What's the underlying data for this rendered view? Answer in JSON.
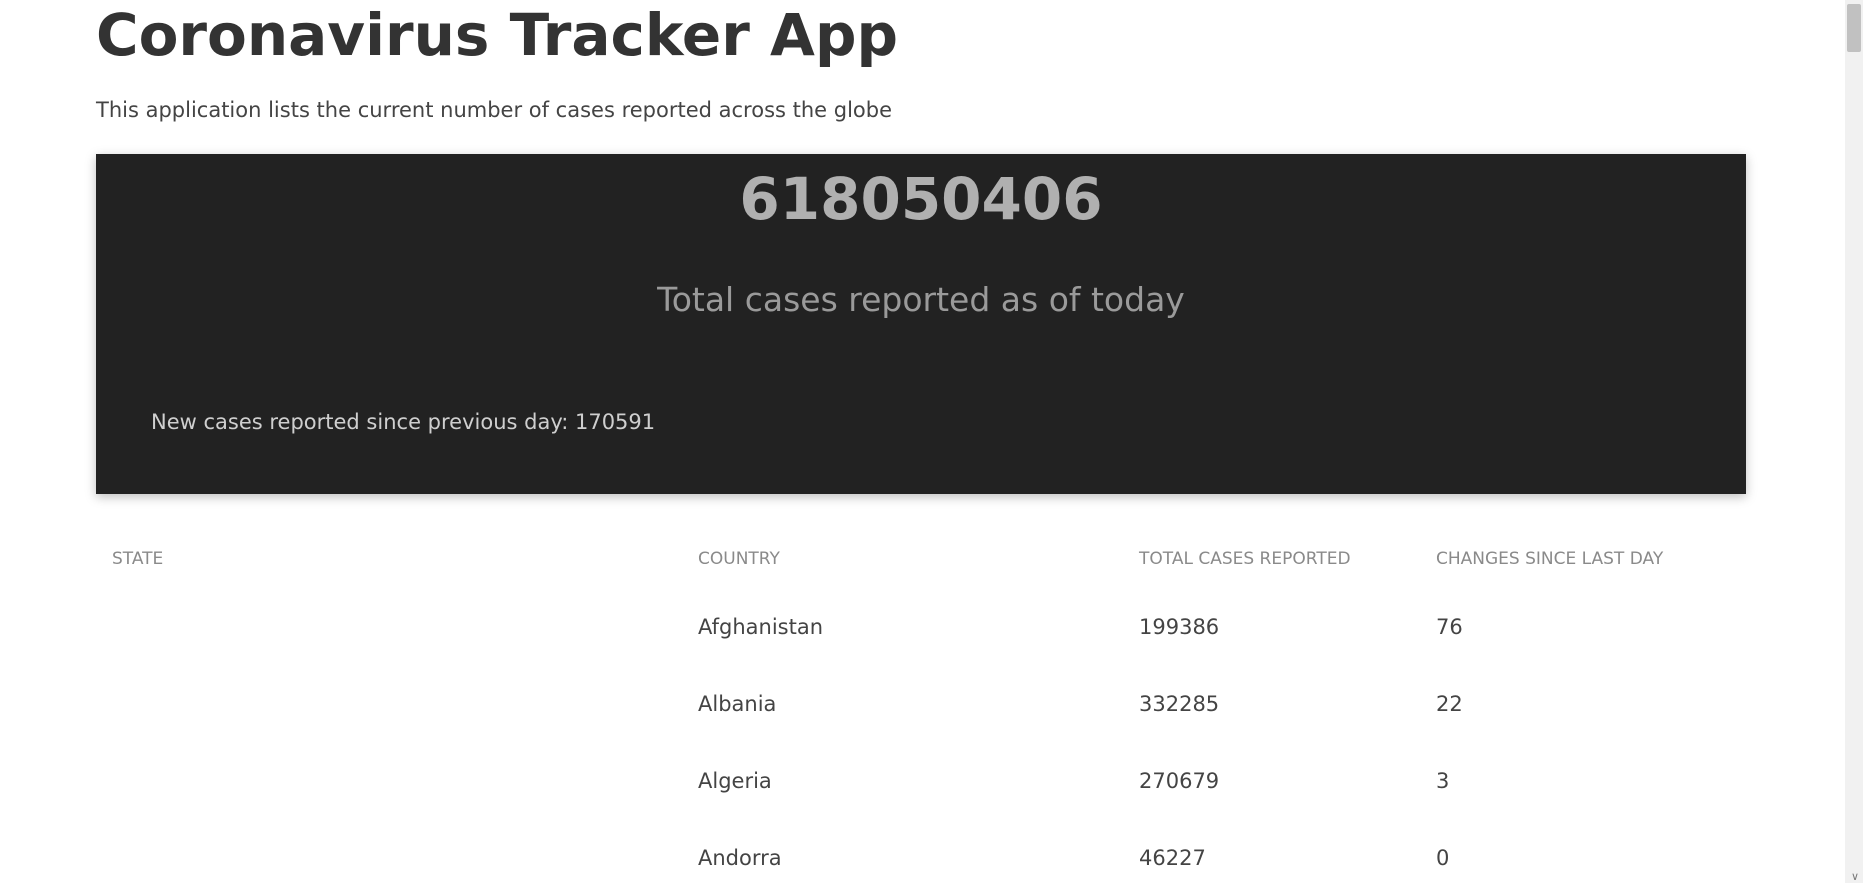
{
  "header": {
    "title": "Coronavirus Tracker App",
    "subtitle": "This application lists the current number of cases reported across the globe"
  },
  "summary": {
    "total_cases": "618050406",
    "total_caption": "Total cases reported as of today",
    "new_cases_label": "New cases reported since previous day: ",
    "new_cases_value": "170591"
  },
  "table": {
    "headers": {
      "state": "STATE",
      "country": "COUNTRY",
      "total": "TOTAL CASES REPORTED",
      "changes": "CHANGES SINCE LAST DAY"
    },
    "rows": [
      {
        "state": "",
        "country": "Afghanistan",
        "total": "199386",
        "changes": "76"
      },
      {
        "state": "",
        "country": "Albania",
        "total": "332285",
        "changes": "22"
      },
      {
        "state": "",
        "country": "Algeria",
        "total": "270679",
        "changes": "3"
      },
      {
        "state": "",
        "country": "Andorra",
        "total": "46227",
        "changes": "0"
      }
    ]
  },
  "scrollbar": {
    "down_arrow_icon": "chevron-down-icon"
  }
}
